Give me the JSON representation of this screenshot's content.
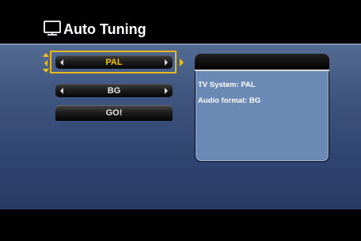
{
  "header": {
    "title": "Auto Tuning",
    "icon": "tv-icon"
  },
  "selectors": [
    {
      "value": "PAL",
      "selected": true
    },
    {
      "value": "BG",
      "selected": false
    }
  ],
  "go_button": {
    "label": "GO!"
  },
  "info": {
    "title": "",
    "tv_system": "TV System: PAL",
    "audio_format": "Audio format: BG"
  },
  "colors": {
    "accent": "#f2c21b",
    "panel": "#3f5680",
    "info_bg": "#6a89b4"
  }
}
